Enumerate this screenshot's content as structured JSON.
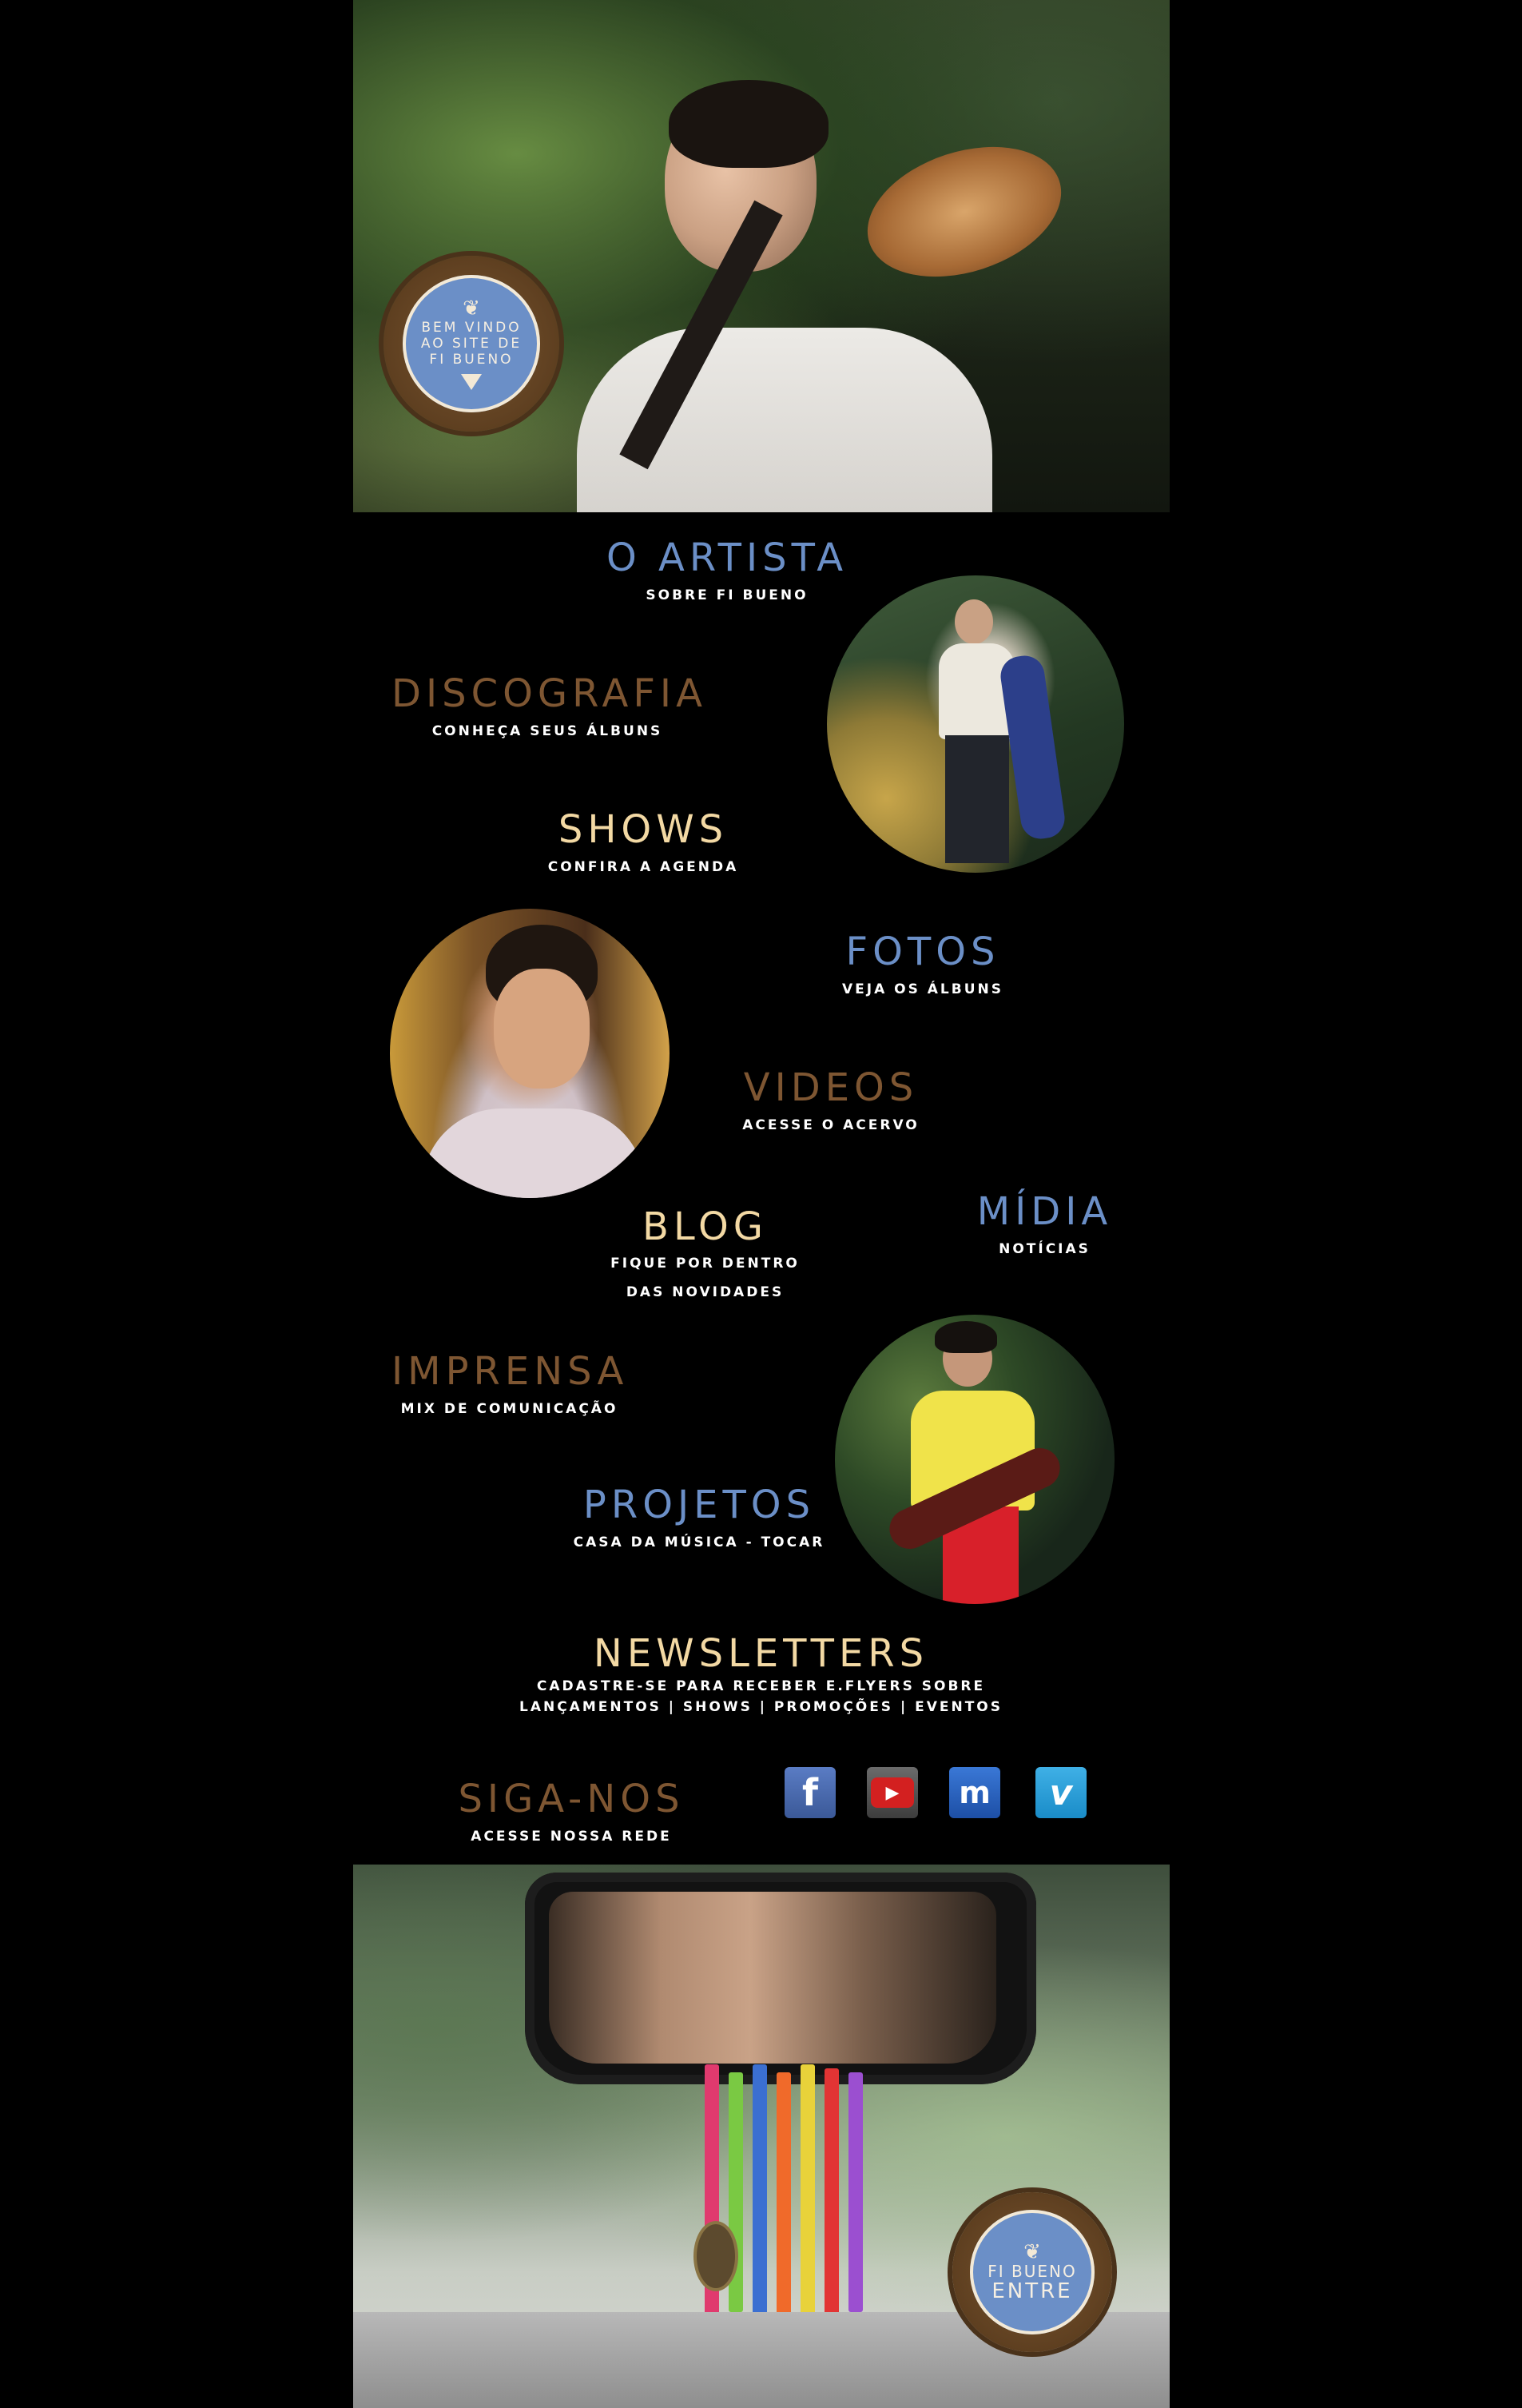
{
  "hero": {
    "badge_line1": "BEM VINDO",
    "badge_line2": "AO SITE DE",
    "badge_line3": "FI BUENO"
  },
  "nav": {
    "artista": {
      "title": "O ARTISTA",
      "sub": "SOBRE FI BUENO"
    },
    "discografia": {
      "title": "DISCOGRAFIA",
      "sub": "CONHEÇA SEUS ÁLBUNS"
    },
    "shows": {
      "title": "SHOWS",
      "sub": "CONFIRA A AGENDA"
    },
    "fotos": {
      "title": "FOTOS",
      "sub": "VEJA OS ÁLBUNS"
    },
    "videos": {
      "title": "VIDEOS",
      "sub": "ACESSE O ACERVO"
    },
    "blog": {
      "title": "BLOG",
      "sub1": "FIQUE POR DENTRO",
      "sub2": "DAS NOVIDADES"
    },
    "midia": {
      "title": "MÍDIA",
      "sub": "NOTÍCIAS"
    },
    "imprensa": {
      "title": "IMPRENSA",
      "sub": "MIX DE COMUNICAÇÃO"
    },
    "projetos": {
      "title": "PROJETOS",
      "sub": "CASA DA MÚSICA - TOCAR"
    },
    "newsletters": {
      "title": "NEWSLETTERS",
      "sub1": "CADASTRE-SE PARA RECEBER E.FLYERS SOBRE",
      "sub2": "LANÇAMENTOS | SHOWS | PROMOÇÕES | EVENTOS"
    },
    "siganos": {
      "title": "SIGA-NOS",
      "sub": "ACESSE NOSSA REDE"
    }
  },
  "social": {
    "facebook": "f",
    "youtube": "▶",
    "myspace": "m",
    "vimeo": "v"
  },
  "footer": {
    "badge_line1": "FI BUENO",
    "badge_line2": "ENTRE"
  },
  "colors": {
    "blue": "#6b8fc7",
    "brown": "#7e5632",
    "cream": "#f3d9a4",
    "background": "#000000"
  }
}
